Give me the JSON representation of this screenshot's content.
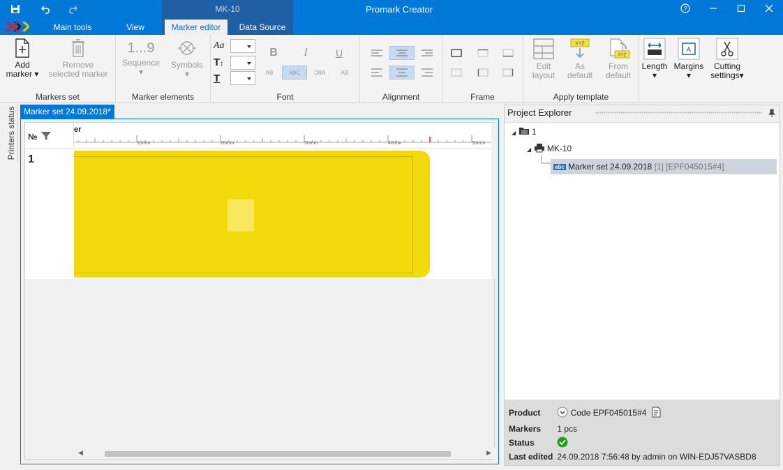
{
  "app": {
    "title": "Promark Creator",
    "context_tab_title": "MK-10"
  },
  "tabs": [
    {
      "label": "Main tools"
    },
    {
      "label": "View"
    },
    {
      "label": "Marker editor"
    },
    {
      "label": "Data Source"
    }
  ],
  "ribbon": {
    "markers_set": {
      "label": "Markers set",
      "add": "Add",
      "add2": "marker",
      "remove": "Remove",
      "remove2": "selected marker"
    },
    "marker_elements": {
      "label": "Marker elements",
      "sequence_icon": "1...9",
      "sequence": "Sequence",
      "symbols": "Symbols"
    },
    "font": {
      "label": "Font",
      "aa": "Aa",
      "t1": "T",
      "t2": "T",
      "bold": "B",
      "italic": "I",
      "underline": "U",
      "s1": "AB",
      "s2": "ABC",
      "s3": "ABC",
      "s4": "AB"
    },
    "alignment": {
      "label": "Alignment"
    },
    "frame": {
      "label": "Frame"
    },
    "apply_template": {
      "label": "Apply template",
      "edit": "Edit",
      "edit2": "layout",
      "as": "As",
      "as2": "default",
      "from": "From",
      "from2": "default",
      "xyz": "XYZ"
    },
    "length": "Length",
    "margins": "Margins",
    "cutting": "Cutting",
    "cutting2": "settings"
  },
  "side": {
    "printers_status": "Printers status"
  },
  "document": {
    "tab": "Marker set 24.09.2018*",
    "col_no": "№",
    "ruler_label": "er",
    "ruler_marks": [
      "10mm",
      "20mm",
      "30mm",
      "40mm",
      "50mm"
    ],
    "row_number": "1"
  },
  "explorer": {
    "title": "Project Explorer",
    "tree": [
      {
        "label": "1"
      },
      {
        "label": "MK-10"
      },
      {
        "label": "Marker set 24.09.2018",
        "extra": "[1] [EPF045015#4]",
        "badge": "abc"
      }
    ],
    "props": {
      "product_label": "Product",
      "product_value": "Code EPF045015#4",
      "markers_label": "Markers",
      "markers_value": "1 pcs",
      "status_label": "Status",
      "edited_label": "Last edited",
      "edited_value": "24.09.2018 7:56:48 by admin on WIN-EDJ57VASBD8"
    }
  },
  "colors": {
    "accent": "#0078d7",
    "marker": "#f2da0a",
    "status_ok": "#1aa31a"
  }
}
